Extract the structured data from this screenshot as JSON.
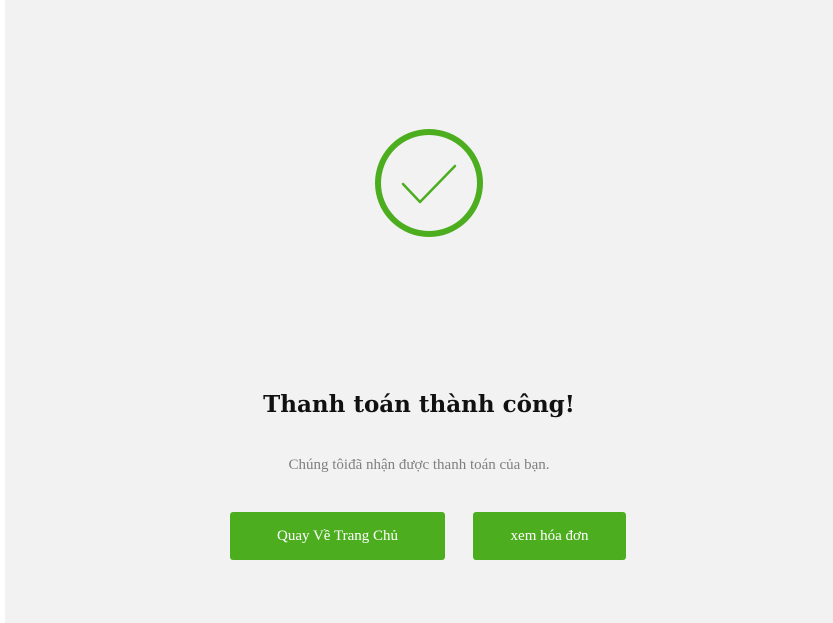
{
  "status": {
    "icon": "check-circle-icon",
    "title": "Thanh toán thành công!",
    "message": "Chúng tôiđã nhận được thanh toán của bạn."
  },
  "actions": {
    "home_label": "Quay Về Trang Chủ",
    "invoice_label": "xem hóa đơn"
  },
  "colors": {
    "accent": "#4cae1f",
    "background": "#f2f2f2",
    "title": "#111111",
    "message": "#808080"
  }
}
